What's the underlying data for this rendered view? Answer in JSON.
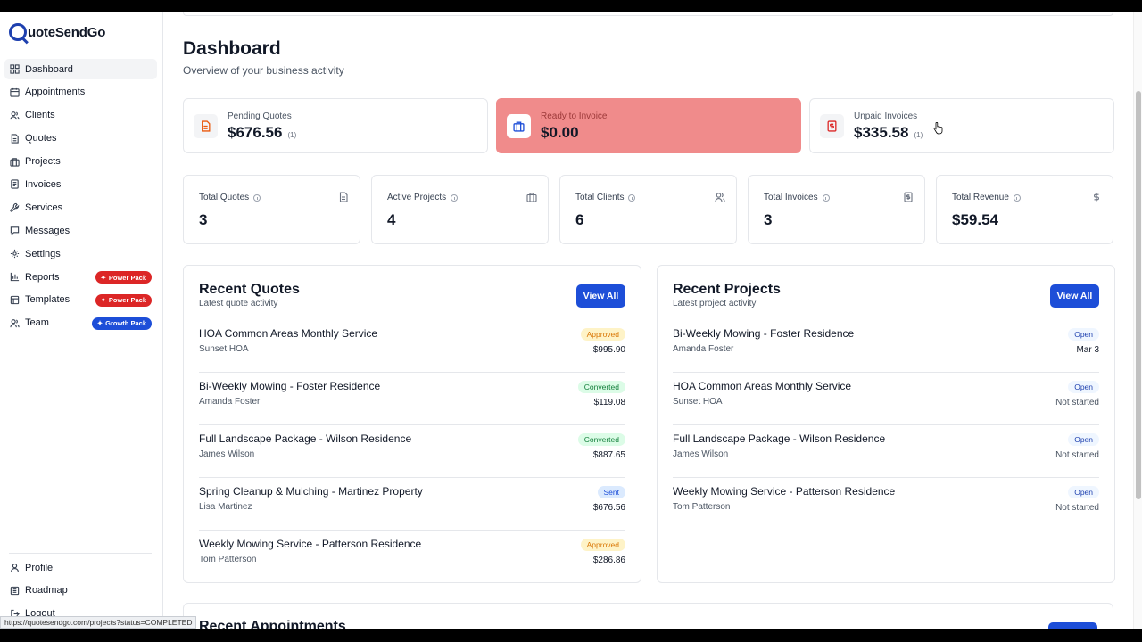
{
  "app": {
    "name": "QuoteSendGo",
    "logo_letter": "Q",
    "logo_rest": "uoteSendGo"
  },
  "sidebar": {
    "items": [
      {
        "label": "Dashboard",
        "icon": "dashboard-icon",
        "active": true
      },
      {
        "label": "Appointments",
        "icon": "calendar-icon"
      },
      {
        "label": "Clients",
        "icon": "users-icon"
      },
      {
        "label": "Quotes",
        "icon": "document-icon"
      },
      {
        "label": "Projects",
        "icon": "briefcase-icon"
      },
      {
        "label": "Invoices",
        "icon": "receipt-icon"
      },
      {
        "label": "Services",
        "icon": "wrench-icon"
      },
      {
        "label": "Messages",
        "icon": "message-icon"
      },
      {
        "label": "Settings",
        "icon": "gear-icon"
      },
      {
        "label": "Reports",
        "icon": "chart-icon",
        "badge": "Power Pack"
      },
      {
        "label": "Templates",
        "icon": "template-icon",
        "badge": "Power Pack"
      },
      {
        "label": "Team",
        "icon": "team-icon",
        "badge": "Growth Pack"
      }
    ],
    "bottom": [
      {
        "label": "Profile",
        "icon": "user-icon"
      },
      {
        "label": "Roadmap",
        "icon": "map-icon"
      },
      {
        "label": "Logout",
        "icon": "logout-icon"
      }
    ]
  },
  "status_url": "https://quotesendgo.com/projects?status=COMPLETED",
  "header": {
    "title": "Dashboard",
    "subtitle": "Overview of your business activity"
  },
  "stat_cards": [
    {
      "label": "Pending Quotes",
      "value": "$676.56",
      "count": "(1)",
      "icon": "document-icon"
    },
    {
      "label": "Ready to Invoice",
      "value": "$0.00",
      "count": "",
      "icon": "briefcase-icon"
    },
    {
      "label": "Unpaid Invoices",
      "value": "$335.58",
      "count": "(1)",
      "icon": "receipt-icon"
    }
  ],
  "metrics": [
    {
      "label": "Total Quotes",
      "value": "3",
      "icon": "document-icon"
    },
    {
      "label": "Active Projects",
      "value": "4",
      "icon": "briefcase-icon"
    },
    {
      "label": "Total Clients",
      "value": "6",
      "icon": "users-icon"
    },
    {
      "label": "Total Invoices",
      "value": "3",
      "icon": "receipt-icon"
    },
    {
      "label": "Total Revenue",
      "value": "$59.54",
      "icon": "dollar-icon"
    }
  ],
  "recent_quotes": {
    "title": "Recent Quotes",
    "subtitle": "Latest quote activity",
    "view_all": "View All",
    "rows": [
      {
        "title": "HOA Common Areas Monthly Service",
        "client": "Sunset HOA",
        "status": "Approved",
        "amount": "$995.90"
      },
      {
        "title": "Bi-Weekly Mowing - Foster Residence",
        "client": "Amanda Foster",
        "status": "Converted",
        "amount": "$119.08"
      },
      {
        "title": "Full Landscape Package - Wilson Residence",
        "client": "James Wilson",
        "status": "Converted",
        "amount": "$887.65"
      },
      {
        "title": "Spring Cleanup & Mulching - Martinez Property",
        "client": "Lisa Martinez",
        "status": "Sent",
        "amount": "$676.56"
      },
      {
        "title": "Weekly Mowing Service - Patterson Residence",
        "client": "Tom Patterson",
        "status": "Approved",
        "amount": "$286.86"
      }
    ]
  },
  "recent_projects": {
    "title": "Recent Projects",
    "subtitle": "Latest project activity",
    "view_all": "View All",
    "rows": [
      {
        "title": "Bi-Weekly Mowing - Foster Residence",
        "client": "Amanda Foster",
        "status": "Open",
        "date": "Mar 3"
      },
      {
        "title": "HOA Common Areas Monthly Service",
        "client": "Sunset HOA",
        "status": "Open",
        "date": "Not started"
      },
      {
        "title": "Full Landscape Package - Wilson Residence",
        "client": "James Wilson",
        "status": "Open",
        "date": "Not started"
      },
      {
        "title": "Weekly Mowing Service - Patterson Residence",
        "client": "Tom Patterson",
        "status": "Open",
        "date": "Not started"
      }
    ]
  },
  "recent_appointments": {
    "title": "Recent Appointments"
  },
  "colors": {
    "brand": "#1e40af",
    "accent": "#1d4ed8",
    "highlight_card": "#f08b8b",
    "power_pack": "#dc2626",
    "growth_pack": "#1d4ed8"
  }
}
